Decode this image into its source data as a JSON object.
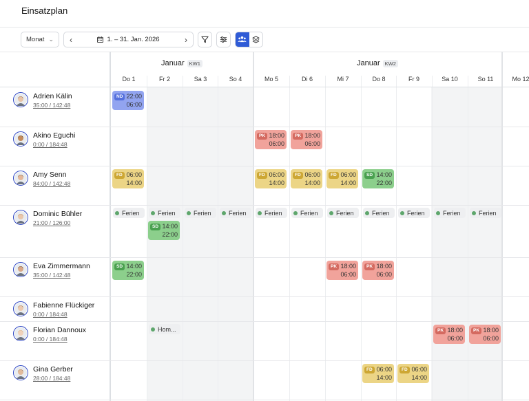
{
  "page": {
    "title": "Einsatzplan"
  },
  "toolbar": {
    "view_mode": "Monat",
    "date_range": "1. – 31. Jan. 2026",
    "prev_icon": "chevron-left-icon",
    "next_icon": "chevron-right-icon",
    "filter_icon": "filter-icon",
    "settings_icon": "sliders-icon",
    "group_people_icon": "people-icon",
    "group_layers_icon": "layers-icon"
  },
  "weeks": [
    {
      "month": "Januar",
      "kw": "KW1"
    },
    {
      "month": "Januar",
      "kw": "KW2"
    }
  ],
  "days": [
    {
      "label": "Do 1"
    },
    {
      "label": "Fr 2"
    },
    {
      "label": "Sa 3"
    },
    {
      "label": "So 4"
    },
    {
      "label": "Mo 5"
    },
    {
      "label": "Di 6"
    },
    {
      "label": "Mi 7"
    },
    {
      "label": "Do 8"
    },
    {
      "label": "Fr 9"
    },
    {
      "label": "Sa 10"
    },
    {
      "label": "So 11"
    },
    {
      "label": "Mo 12"
    }
  ],
  "colors": {
    "accent": "#2f5bd6",
    "ND_bg": "#92a4f0",
    "ND_badge": "#5570dd",
    "PK_bg": "#f1a39b",
    "PK_badge": "#d46a60",
    "FD_bg": "#ecd586",
    "FD_badge": "#cda734",
    "SD_bg": "#8ccf8c",
    "SD_badge": "#49a04f",
    "absence_dot": "#5ea66c"
  },
  "employees": [
    {
      "name": "Adrien Kälin",
      "hours": "35:00 / 142:48",
      "shifts": [
        {
          "day": 0,
          "code": "ND",
          "start": "22:00",
          "end": "06:00"
        }
      ],
      "absences": []
    },
    {
      "name": "Akino Eguchi",
      "hours": "0:00 / 184:48",
      "shifts": [
        {
          "day": 4,
          "code": "PK",
          "start": "18:00",
          "end": "06:00"
        },
        {
          "day": 5,
          "code": "PK",
          "start": "18:00",
          "end": "06:00"
        }
      ],
      "absences": []
    },
    {
      "name": "Amy Senn",
      "hours": "84:00 / 142:48",
      "shifts": [
        {
          "day": 0,
          "code": "FD",
          "start": "06:00",
          "end": "14:00"
        },
        {
          "day": 4,
          "code": "FD",
          "start": "06:00",
          "end": "14:00"
        },
        {
          "day": 5,
          "code": "FD",
          "start": "06:00",
          "end": "14:00"
        },
        {
          "day": 6,
          "code": "FD",
          "start": "06:00",
          "end": "14:00"
        },
        {
          "day": 7,
          "code": "SD",
          "start": "14:00",
          "end": "22:00"
        }
      ],
      "absences": []
    },
    {
      "name": "Dominic Bühler",
      "hours": "21:00 / 126:00",
      "shifts": [
        {
          "day": 1,
          "code": "SD",
          "start": "14:00",
          "end": "22:00"
        }
      ],
      "absences": [
        {
          "day": 0,
          "label": "Ferien"
        },
        {
          "day": 1,
          "label": "Ferien"
        },
        {
          "day": 2,
          "label": "Ferien"
        },
        {
          "day": 3,
          "label": "Ferien"
        },
        {
          "day": 4,
          "label": "Ferien"
        },
        {
          "day": 5,
          "label": "Ferien"
        },
        {
          "day": 6,
          "label": "Ferien"
        },
        {
          "day": 7,
          "label": "Ferien"
        },
        {
          "day": 8,
          "label": "Ferien"
        },
        {
          "day": 9,
          "label": "Ferien"
        },
        {
          "day": 10,
          "label": "Ferien"
        }
      ]
    },
    {
      "name": "Eva Zimmermann",
      "hours": "35:00 / 142:48",
      "shifts": [
        {
          "day": 0,
          "code": "SD",
          "start": "14:00",
          "end": "22:00"
        },
        {
          "day": 6,
          "code": "PK",
          "start": "18:00",
          "end": "06:00"
        },
        {
          "day": 7,
          "code": "PK",
          "start": "18:00",
          "end": "06:00"
        }
      ],
      "absences": []
    },
    {
      "name": "Fabienne Flückiger",
      "hours": "0:00 / 184:48",
      "shifts": [],
      "absences": []
    },
    {
      "name": "Florian Dannoux",
      "hours": "0:00 / 184:48",
      "shifts": [
        {
          "day": 9,
          "code": "PK",
          "start": "18:00",
          "end": "06:00"
        },
        {
          "day": 10,
          "code": "PK",
          "start": "18:00",
          "end": "06:00"
        }
      ],
      "absences": [
        {
          "day": 1,
          "label": "Hom..."
        }
      ]
    },
    {
      "name": "Gina Gerber",
      "hours": "28:00 / 184:48",
      "shifts": [
        {
          "day": 7,
          "code": "FD",
          "start": "06:00",
          "end": "14:00"
        },
        {
          "day": 8,
          "code": "FD",
          "start": "06:00",
          "end": "14:00"
        }
      ],
      "absences": []
    }
  ]
}
